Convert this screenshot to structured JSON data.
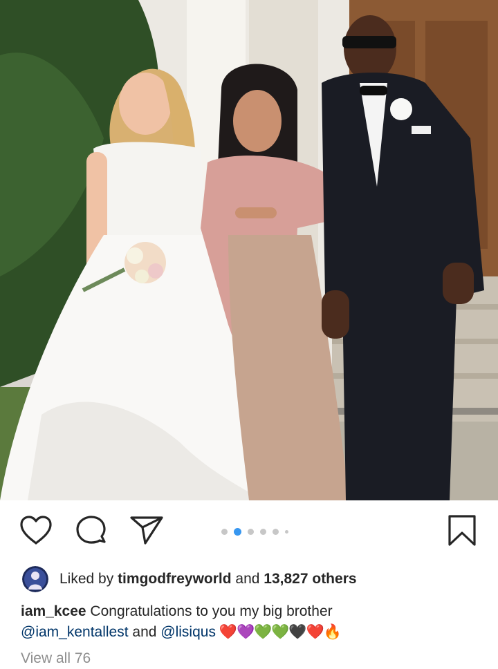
{
  "post": {
    "photo_alt": "Wedding photo",
    "carousel": {
      "total_dots": 6,
      "active_index": 1
    },
    "likes": {
      "prefix": "Liked by ",
      "user": "timgodfreyworld",
      "middle": " and ",
      "count": "13,827 others"
    },
    "caption": {
      "username": "iam_kcee",
      "text": " Congratulations to you my big brother",
      "mention1": "@iam_kentallest",
      "and": " and ",
      "mention2": "@lisiqus",
      "emoji": " ❤️💜💚💚🖤❤️🔥"
    },
    "footer_text": "View all 76"
  },
  "icons": {
    "like": "heart-icon",
    "comment": "comment-icon",
    "share": "send-icon",
    "save": "bookmark-icon"
  },
  "colors": {
    "active_dot": "#3897f0",
    "inactive_dot": "#c7c7c7",
    "mention": "#003569"
  }
}
